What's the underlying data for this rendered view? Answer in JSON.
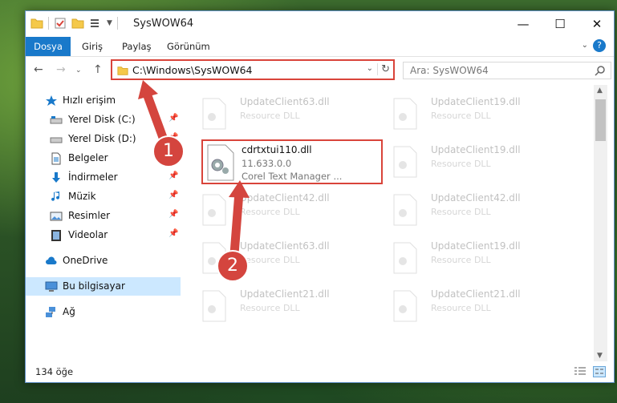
{
  "window": {
    "title": "SysWOW64",
    "controls": {
      "minimize": "—",
      "maximize": "☐",
      "close": "✕"
    }
  },
  "ribbon": {
    "tabs": [
      "Dosya",
      "Giriş",
      "Paylaş",
      "Görünüm"
    ],
    "help": "?"
  },
  "navigation": {
    "address_path": "C:\\Windows\\SysWOW64",
    "search_placeholder": "Ara: SysWOW64"
  },
  "sidebar": {
    "items": [
      {
        "label": "Hızlı erişim",
        "icon": "star-icon"
      },
      {
        "label": "Yerel Disk (C:)",
        "icon": "drive-icon",
        "pinned": true
      },
      {
        "label": "Yerel Disk (D:)",
        "icon": "drive-icon",
        "pinned": true
      },
      {
        "label": "Belgeler",
        "icon": "document-icon",
        "pinned": true
      },
      {
        "label": "İndirmeler",
        "icon": "download-icon",
        "pinned": true
      },
      {
        "label": "Müzik",
        "icon": "music-icon",
        "pinned": true
      },
      {
        "label": "Resimler",
        "icon": "pictures-icon",
        "pinned": true
      },
      {
        "label": "Videolar",
        "icon": "video-icon",
        "pinned": true
      },
      {
        "label": "OneDrive",
        "icon": "cloud-icon"
      },
      {
        "label": "Bu bilgisayar",
        "icon": "computer-icon",
        "selected": true
      },
      {
        "label": "Ağ",
        "icon": "network-icon"
      }
    ]
  },
  "files": {
    "faded": [
      {
        "name": "UpdateClient63.dll",
        "desc": "Resource DLL"
      },
      {
        "name": "UpdateClient19.dll",
        "desc": "Resource DLL"
      },
      {
        "name": "UpdateClient19.dll",
        "desc": "Resource DLL"
      },
      {
        "name": "UpdateClient42.dll",
        "desc": "Resource DLL"
      },
      {
        "name": "UpdateClient42.dll",
        "desc": "Resource DLL"
      },
      {
        "name": "UpdateClient63.dll",
        "desc": "Resource DLL"
      },
      {
        "name": "UpdateClient19.dll",
        "desc": "Resource DLL"
      },
      {
        "name": "UpdateClient21.dll",
        "desc": "Resource DLL"
      },
      {
        "name": "UpdateClient21.dll",
        "desc": "Resource DLL"
      }
    ],
    "selected": {
      "name": "cdrtxtui110.dll",
      "version": "11.633.0.0",
      "description": "Corel Text Manager ..."
    }
  },
  "status": {
    "item_count": "134 öğe"
  },
  "annotations": {
    "step1": "1",
    "step2": "2"
  },
  "colors": {
    "accent": "#1979ca",
    "highlight": "#d9443a",
    "selection": "#cce8ff"
  }
}
